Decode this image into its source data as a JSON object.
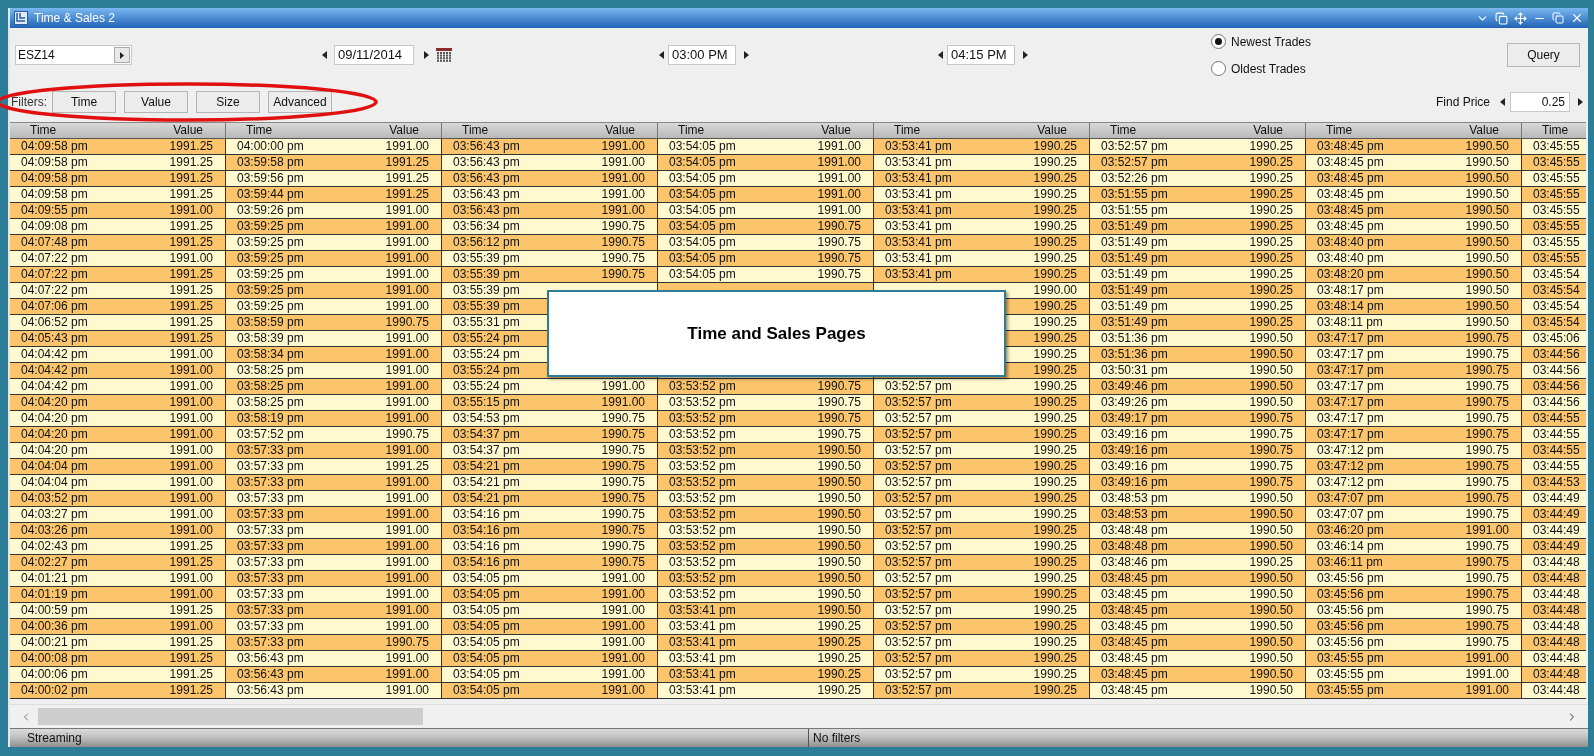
{
  "window": {
    "title": "Time & Sales 2"
  },
  "toolbar": {
    "symbol": "ESZ14",
    "date": "09/11/2014",
    "start_time": "03:00 PM",
    "end_time": "04:15 PM",
    "sort_options": [
      {
        "label": "Newest Trades",
        "selected": true
      },
      {
        "label": "Oldest Trades",
        "selected": false
      }
    ],
    "query_button": "Query"
  },
  "filters": {
    "label": "Filters:",
    "buttons": [
      "Time",
      "Value",
      "Size",
      "Advanced"
    ]
  },
  "find_price": {
    "label": "Find Price",
    "value": "0.25"
  },
  "table": {
    "columns": [
      "Time",
      "Value",
      "Time",
      "Value",
      "Time",
      "Value",
      "Time",
      "Value",
      "Time",
      "Value",
      "Time",
      "Value",
      "Time",
      "Value",
      "Time"
    ],
    "rows": [
      [
        "04:09:58 pm",
        "1991.25",
        "04:00:00 pm",
        "1991.00",
        "03:56:43 pm",
        "1991.00",
        "03:54:05 pm",
        "1991.00",
        "03:53:41 pm",
        "1990.25",
        "03:52:57 pm",
        "1990.25",
        "03:48:45 pm",
        "1990.50",
        "03:45:55"
      ],
      [
        "04:09:58 pm",
        "1991.25",
        "03:59:58 pm",
        "1991.25",
        "03:56:43 pm",
        "1991.00",
        "03:54:05 pm",
        "1991.00",
        "03:53:41 pm",
        "1990.25",
        "03:52:57 pm",
        "1990.25",
        "03:48:45 pm",
        "1990.50",
        "03:45:55"
      ],
      [
        "04:09:58 pm",
        "1991.25",
        "03:59:56 pm",
        "1991.25",
        "03:56:43 pm",
        "1991.00",
        "03:54:05 pm",
        "1991.00",
        "03:53:41 pm",
        "1990.25",
        "03:52:26 pm",
        "1990.25",
        "03:48:45 pm",
        "1990.50",
        "03:45:55"
      ],
      [
        "04:09:58 pm",
        "1991.25",
        "03:59:44 pm",
        "1991.25",
        "03:56:43 pm",
        "1991.00",
        "03:54:05 pm",
        "1991.00",
        "03:53:41 pm",
        "1990.25",
        "03:51:55 pm",
        "1990.25",
        "03:48:45 pm",
        "1990.50",
        "03:45:55"
      ],
      [
        "04:09:55 pm",
        "1991.00",
        "03:59:26 pm",
        "1991.00",
        "03:56:43 pm",
        "1991.00",
        "03:54:05 pm",
        "1991.00",
        "03:53:41 pm",
        "1990.25",
        "03:51:55 pm",
        "1990.25",
        "03:48:45 pm",
        "1990.50",
        "03:45:55"
      ],
      [
        "04:09:08 pm",
        "1991.25",
        "03:59:25 pm",
        "1991.00",
        "03:56:34 pm",
        "1990.75",
        "03:54:05 pm",
        "1990.75",
        "03:53:41 pm",
        "1990.25",
        "03:51:49 pm",
        "1990.25",
        "03:48:45 pm",
        "1990.50",
        "03:45:55"
      ],
      [
        "04:07:48 pm",
        "1991.25",
        "03:59:25 pm",
        "1991.00",
        "03:56:12 pm",
        "1990.75",
        "03:54:05 pm",
        "1990.75",
        "03:53:41 pm",
        "1990.25",
        "03:51:49 pm",
        "1990.25",
        "03:48:40 pm",
        "1990.50",
        "03:45:55"
      ],
      [
        "04:07:22 pm",
        "1991.00",
        "03:59:25 pm",
        "1991.00",
        "03:55:39 pm",
        "1990.75",
        "03:54:05 pm",
        "1990.75",
        "03:53:41 pm",
        "1990.25",
        "03:51:49 pm",
        "1990.25",
        "03:48:40 pm",
        "1990.50",
        "03:45:55"
      ],
      [
        "04:07:22 pm",
        "1991.25",
        "03:59:25 pm",
        "1991.00",
        "03:55:39 pm",
        "1990.75",
        "03:54:05 pm",
        "1990.75",
        "03:53:41 pm",
        "1990.25",
        "03:51:49 pm",
        "1990.25",
        "03:48:20 pm",
        "1990.50",
        "03:45:54"
      ],
      [
        "04:07:22 pm",
        "1991.25",
        "03:59:25 pm",
        "1991.00",
        "03:55:39 pm",
        null,
        null,
        null,
        null,
        "1990.00",
        "03:51:49 pm",
        "1990.25",
        "03:48:17 pm",
        "1990.50",
        "03:45:54"
      ],
      [
        "04:07:06 pm",
        "1991.25",
        "03:59:25 pm",
        "1991.00",
        "03:55:39 pm",
        null,
        null,
        null,
        null,
        "1990.25",
        "03:51:49 pm",
        "1990.25",
        "03:48:14 pm",
        "1990.50",
        "03:45:54"
      ],
      [
        "04:06:52 pm",
        "1991.25",
        "03:58:59 pm",
        "1990.75",
        "03:55:31 pm",
        null,
        null,
        null,
        null,
        "1990.25",
        "03:51:49 pm",
        "1990.25",
        "03:48:11 pm",
        "1990.50",
        "03:45:54"
      ],
      [
        "04:05:43 pm",
        "1991.25",
        "03:58:39 pm",
        "1991.00",
        "03:55:24 pm",
        null,
        null,
        null,
        null,
        "1990.25",
        "03:51:36 pm",
        "1990.50",
        "03:47:17 pm",
        "1990.75",
        "03:45:06"
      ],
      [
        "04:04:42 pm",
        "1991.00",
        "03:58:34 pm",
        "1991.00",
        "03:55:24 pm",
        null,
        null,
        null,
        null,
        "1990.25",
        "03:51:36 pm",
        "1990.50",
        "03:47:17 pm",
        "1990.75",
        "03:44:56"
      ],
      [
        "04:04:42 pm",
        "1991.00",
        "03:58:25 pm",
        "1991.00",
        "03:55:24 pm",
        null,
        null,
        null,
        null,
        "1990.25",
        "03:50:31 pm",
        "1990.50",
        "03:47:17 pm",
        "1990.75",
        "03:44:56"
      ],
      [
        "04:04:42 pm",
        "1991.00",
        "03:58:25 pm",
        "1991.00",
        "03:55:24 pm",
        "1991.00",
        "03:53:52 pm",
        "1990.75",
        "03:52:57 pm",
        "1990.25",
        "03:49:46 pm",
        "1990.50",
        "03:47:17 pm",
        "1990.75",
        "03:44:56"
      ],
      [
        "04:04:20 pm",
        "1991.00",
        "03:58:25 pm",
        "1991.00",
        "03:55:15 pm",
        "1991.00",
        "03:53:52 pm",
        "1990.75",
        "03:52:57 pm",
        "1990.25",
        "03:49:26 pm",
        "1990.50",
        "03:47:17 pm",
        "1990.75",
        "03:44:56"
      ],
      [
        "04:04:20 pm",
        "1991.00",
        "03:58:19 pm",
        "1991.00",
        "03:54:53 pm",
        "1990.75",
        "03:53:52 pm",
        "1990.75",
        "03:52:57 pm",
        "1990.25",
        "03:49:17 pm",
        "1990.75",
        "03:47:17 pm",
        "1990.75",
        "03:44:55"
      ],
      [
        "04:04:20 pm",
        "1991.00",
        "03:57:52 pm",
        "1990.75",
        "03:54:37 pm",
        "1990.75",
        "03:53:52 pm",
        "1990.75",
        "03:52:57 pm",
        "1990.25",
        "03:49:16 pm",
        "1990.75",
        "03:47:17 pm",
        "1990.75",
        "03:44:55"
      ],
      [
        "04:04:20 pm",
        "1991.00",
        "03:57:33 pm",
        "1991.00",
        "03:54:37 pm",
        "1990.75",
        "03:53:52 pm",
        "1990.50",
        "03:52:57 pm",
        "1990.25",
        "03:49:16 pm",
        "1990.75",
        "03:47:12 pm",
        "1990.75",
        "03:44:55"
      ],
      [
        "04:04:04 pm",
        "1991.00",
        "03:57:33 pm",
        "1991.25",
        "03:54:21 pm",
        "1990.75",
        "03:53:52 pm",
        "1990.50",
        "03:52:57 pm",
        "1990.25",
        "03:49:16 pm",
        "1990.75",
        "03:47:12 pm",
        "1990.75",
        "03:44:55"
      ],
      [
        "04:04:04 pm",
        "1991.00",
        "03:57:33 pm",
        "1991.00",
        "03:54:21 pm",
        "1990.75",
        "03:53:52 pm",
        "1990.50",
        "03:52:57 pm",
        "1990.25",
        "03:49:16 pm",
        "1990.75",
        "03:47:12 pm",
        "1990.75",
        "03:44:53"
      ],
      [
        "04:03:52 pm",
        "1991.00",
        "03:57:33 pm",
        "1991.00",
        "03:54:21 pm",
        "1990.75",
        "03:53:52 pm",
        "1990.50",
        "03:52:57 pm",
        "1990.25",
        "03:48:53 pm",
        "1990.50",
        "03:47:07 pm",
        "1990.75",
        "03:44:49"
      ],
      [
        "04:03:27 pm",
        "1991.00",
        "03:57:33 pm",
        "1991.00",
        "03:54:16 pm",
        "1990.75",
        "03:53:52 pm",
        "1990.50",
        "03:52:57 pm",
        "1990.25",
        "03:48:53 pm",
        "1990.50",
        "03:47:07 pm",
        "1990.75",
        "03:44:49"
      ],
      [
        "04:03:26 pm",
        "1991.00",
        "03:57:33 pm",
        "1991.00",
        "03:54:16 pm",
        "1990.75",
        "03:53:52 pm",
        "1990.50",
        "03:52:57 pm",
        "1990.25",
        "03:48:48 pm",
        "1990.50",
        "03:46:20 pm",
        "1991.00",
        "03:44:49"
      ],
      [
        "04:02:43 pm",
        "1991.25",
        "03:57:33 pm",
        "1991.00",
        "03:54:16 pm",
        "1990.75",
        "03:53:52 pm",
        "1990.50",
        "03:52:57 pm",
        "1990.25",
        "03:48:48 pm",
        "1990.50",
        "03:46:14 pm",
        "1990.75",
        "03:44:49"
      ],
      [
        "04:02:27 pm",
        "1991.25",
        "03:57:33 pm",
        "1991.00",
        "03:54:16 pm",
        "1990.75",
        "03:53:52 pm",
        "1990.50",
        "03:52:57 pm",
        "1990.25",
        "03:48:46 pm",
        "1990.25",
        "03:46:11 pm",
        "1990.75",
        "03:44:48"
      ],
      [
        "04:01:21 pm",
        "1991.00",
        "03:57:33 pm",
        "1991.00",
        "03:54:05 pm",
        "1991.00",
        "03:53:52 pm",
        "1990.50",
        "03:52:57 pm",
        "1990.25",
        "03:48:45 pm",
        "1990.50",
        "03:45:56 pm",
        "1990.75",
        "03:44:48"
      ],
      [
        "04:01:19 pm",
        "1991.00",
        "03:57:33 pm",
        "1991.00",
        "03:54:05 pm",
        "1991.00",
        "03:53:52 pm",
        "1990.50",
        "03:52:57 pm",
        "1990.25",
        "03:48:45 pm",
        "1990.50",
        "03:45:56 pm",
        "1990.75",
        "03:44:48"
      ],
      [
        "04:00:59 pm",
        "1991.25",
        "03:57:33 pm",
        "1991.00",
        "03:54:05 pm",
        "1991.00",
        "03:53:41 pm",
        "1990.50",
        "03:52:57 pm",
        "1990.25",
        "03:48:45 pm",
        "1990.50",
        "03:45:56 pm",
        "1990.75",
        "03:44:48"
      ],
      [
        "04:00:36 pm",
        "1991.00",
        "03:57:33 pm",
        "1991.00",
        "03:54:05 pm",
        "1991.00",
        "03:53:41 pm",
        "1990.25",
        "03:52:57 pm",
        "1990.25",
        "03:48:45 pm",
        "1990.50",
        "03:45:56 pm",
        "1990.75",
        "03:44:48"
      ],
      [
        "04:00:21 pm",
        "1991.25",
        "03:57:33 pm",
        "1990.75",
        "03:54:05 pm",
        "1991.00",
        "03:53:41 pm",
        "1990.25",
        "03:52:57 pm",
        "1990.25",
        "03:48:45 pm",
        "1990.50",
        "03:45:56 pm",
        "1990.75",
        "03:44:48"
      ],
      [
        "04:00:08 pm",
        "1991.25",
        "03:56:43 pm",
        "1991.00",
        "03:54:05 pm",
        "1991.00",
        "03:53:41 pm",
        "1990.25",
        "03:52:57 pm",
        "1990.25",
        "03:48:45 pm",
        "1990.50",
        "03:45:55 pm",
        "1991.00",
        "03:44:48"
      ],
      [
        "04:00:06 pm",
        "1991.25",
        "03:56:43 pm",
        "1991.00",
        "03:54:05 pm",
        "1991.00",
        "03:53:41 pm",
        "1990.25",
        "03:52:57 pm",
        "1990.25",
        "03:48:45 pm",
        "1990.50",
        "03:45:55 pm",
        "1991.00",
        "03:44:48"
      ],
      [
        "04:00:02 pm",
        "1991.25",
        "03:56:43 pm",
        "1991.00",
        "03:54:05 pm",
        "1991.00",
        "03:53:41 pm",
        "1990.25",
        "03:52:57 pm",
        "1990.25",
        "03:48:45 pm",
        "1990.50",
        "03:45:55 pm",
        "1991.00",
        "03:44:48"
      ]
    ]
  },
  "callout": {
    "title": "Time and Sales Pages"
  },
  "status_bar": {
    "left": "Streaming",
    "right": "No filters"
  }
}
